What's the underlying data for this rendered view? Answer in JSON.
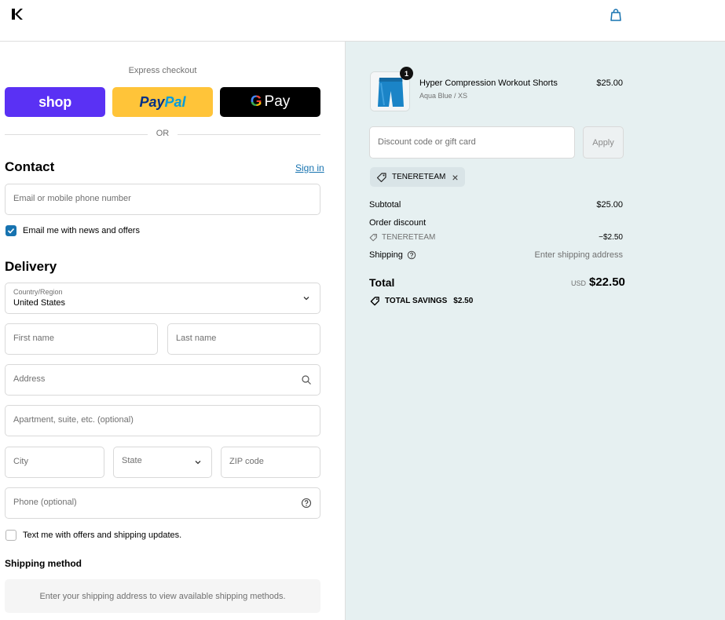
{
  "header": {
    "logo_icon": "store-logo-k",
    "bag_icon": "shopping-bag-icon"
  },
  "express": {
    "label": "Express checkout",
    "shop_label": "shop",
    "paypal_label_1": "Pay",
    "paypal_label_2": "Pal",
    "gpay_g": "G",
    "gpay_label": "Pay",
    "or_label": "OR"
  },
  "contact": {
    "title": "Contact",
    "signin_label": "Sign in",
    "email_placeholder": "Email or mobile phone number",
    "news_label": "Email me with news and offers",
    "news_checked": true
  },
  "delivery": {
    "title": "Delivery",
    "country_label": "Country/Region",
    "country_value": "United States",
    "first_name_placeholder": "First name",
    "last_name_placeholder": "Last name",
    "address_placeholder": "Address",
    "apartment_placeholder": "Apartment, suite, etc. (optional)",
    "city_placeholder": "City",
    "state_placeholder": "State",
    "zip_placeholder": "ZIP code",
    "phone_placeholder": "Phone (optional)",
    "sms_label": "Text me with offers and shipping updates.",
    "sms_checked": false
  },
  "shipping_method": {
    "title": "Shipping method",
    "message": "Enter your shipping address to view available shipping methods."
  },
  "summary": {
    "product": {
      "name": "Hyper Compression Workout Shorts",
      "variant": "Aqua Blue / XS",
      "price": "$25.00",
      "quantity": "1"
    },
    "discount_placeholder": "Discount code or gift card",
    "apply_label": "Apply",
    "applied_code": "TENERETEAM",
    "subtotal_label": "Subtotal",
    "subtotal_value": "$25.00",
    "order_discount_label": "Order discount",
    "discount_code": "TENERETEAM",
    "discount_value": "−$2.50",
    "shipping_label": "Shipping",
    "shipping_value": "Enter shipping address",
    "total_label": "Total",
    "total_currency": "USD",
    "total_value": "$22.50",
    "savings_label": "TOTAL SAVINGS",
    "savings_value": "$2.50"
  },
  "colors": {
    "accent": "#1773b0",
    "summary_bg": "#e6f0f1",
    "shop": "#5a31f4",
    "paypal": "#ffc439"
  }
}
